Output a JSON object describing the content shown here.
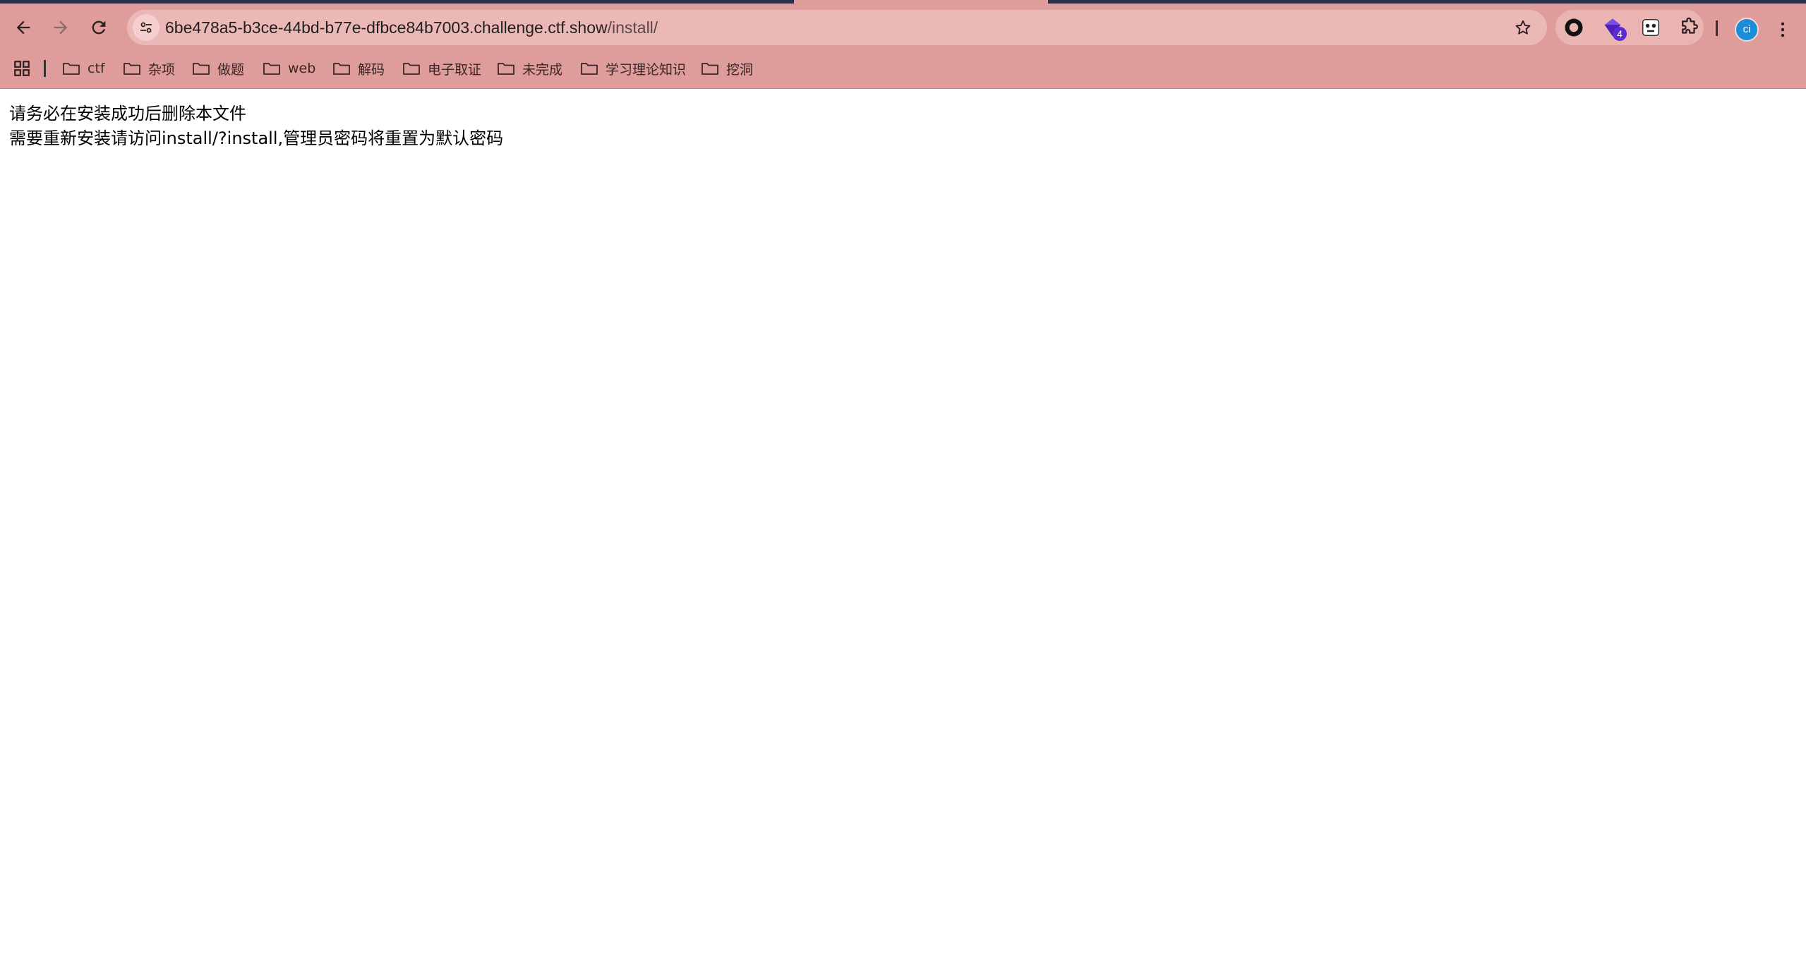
{
  "browser": {
    "address_bar": {
      "host": "6be478a5-b3ce-44bd-b77e-dfbce84b7003.challenge.ctf.show",
      "path": "/install/"
    },
    "extensions": [
      {
        "icon": "circle-record-icon"
      },
      {
        "icon": "purple-gem-icon",
        "badge": "4"
      },
      {
        "icon": "panda-icon"
      },
      {
        "icon": "puzzle-icon"
      }
    ],
    "profile_initials": "ci",
    "colors": {
      "frame": "#de9c9a",
      "omnibox": "#ebb8b6",
      "avatar": "#1a8ed8",
      "badge": "#5b2bd1"
    }
  },
  "bookmarks": [
    {
      "label": "ctf"
    },
    {
      "label": "杂项"
    },
    {
      "label": "做题"
    },
    {
      "label": "web"
    },
    {
      "label": "解码"
    },
    {
      "label": "电子取证"
    },
    {
      "label": "未完成"
    },
    {
      "label": "学习理论知识"
    },
    {
      "label": "挖洞"
    }
  ],
  "page": {
    "lines": [
      "请务必在安装成功后删除本文件",
      "需要重新安装请访问install/?install,管理员密码将重置为默认密码"
    ]
  }
}
